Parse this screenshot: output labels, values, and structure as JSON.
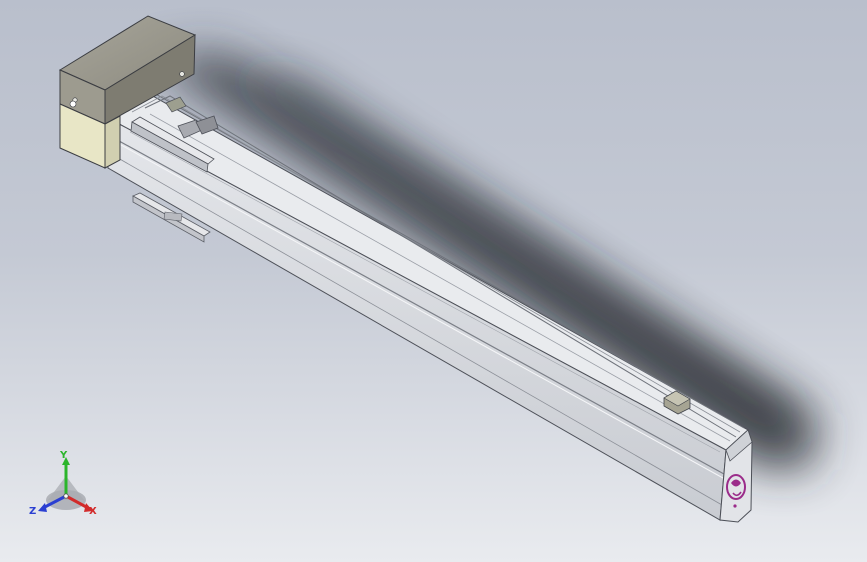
{
  "viewport": {
    "background_top": "#b9bfcc",
    "background_bottom": "#e9ebef"
  },
  "model": {
    "body_color": "#d7d9de",
    "motor_color": "#9c9a8c",
    "shadow_color": "#2c2f36",
    "logo_color": "#9b2c8a"
  },
  "triad": {
    "x_label": "X",
    "y_label": "Y",
    "z_label": "Z",
    "x_color": "#d22b2b",
    "y_color": "#2bb52b",
    "z_color": "#2b3fd2"
  }
}
